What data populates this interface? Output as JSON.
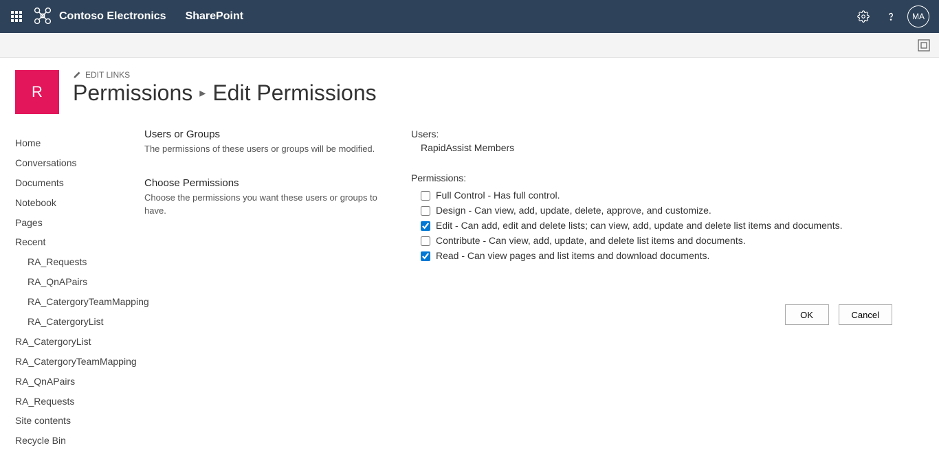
{
  "header": {
    "org_name": "Contoso Electronics",
    "app_name": "SharePoint",
    "avatar_initials": "MA"
  },
  "page": {
    "site_letter": "R",
    "edit_links_label": "EDIT LINKS",
    "breadcrumb_parent": "Permissions",
    "breadcrumb_current": "Edit Permissions"
  },
  "sidenav": {
    "items": [
      {
        "label": "Home",
        "indent": false
      },
      {
        "label": "Conversations",
        "indent": false
      },
      {
        "label": "Documents",
        "indent": false
      },
      {
        "label": "Notebook",
        "indent": false
      },
      {
        "label": "Pages",
        "indent": false
      },
      {
        "label": "Recent",
        "indent": false
      },
      {
        "label": "RA_Requests",
        "indent": true
      },
      {
        "label": "RA_QnAPairs",
        "indent": true
      },
      {
        "label": "RA_CatergoryTeamMapping",
        "indent": true
      },
      {
        "label": "RA_CatergoryList",
        "indent": true
      },
      {
        "label": "RA_CatergoryList",
        "indent": false
      },
      {
        "label": "RA_CatergoryTeamMapping",
        "indent": false
      },
      {
        "label": "RA_QnAPairs",
        "indent": false
      },
      {
        "label": "RA_Requests",
        "indent": false
      },
      {
        "label": "Site contents",
        "indent": false
      },
      {
        "label": "Recycle Bin",
        "indent": false
      }
    ]
  },
  "form": {
    "section1_title": "Users or Groups",
    "section1_desc": "The permissions of these users or groups will be modified.",
    "section2_title": "Choose Permissions",
    "section2_desc": "Choose the permissions you want these users or groups to have.",
    "users_label": "Users:",
    "users_value": "RapidAssist Members",
    "permissions_label": "Permissions:",
    "permissions": [
      {
        "label": "Full Control - Has full control.",
        "checked": false
      },
      {
        "label": "Design - Can view, add, update, delete, approve, and customize.",
        "checked": false
      },
      {
        "label": "Edit - Can add, edit and delete lists; can view, add, update and delete list items and documents.",
        "checked": true
      },
      {
        "label": "Contribute - Can view, add, update, and delete list items and documents.",
        "checked": false
      },
      {
        "label": "Read - Can view pages and list items and download documents.",
        "checked": true
      }
    ],
    "ok_label": "OK",
    "cancel_label": "Cancel"
  }
}
